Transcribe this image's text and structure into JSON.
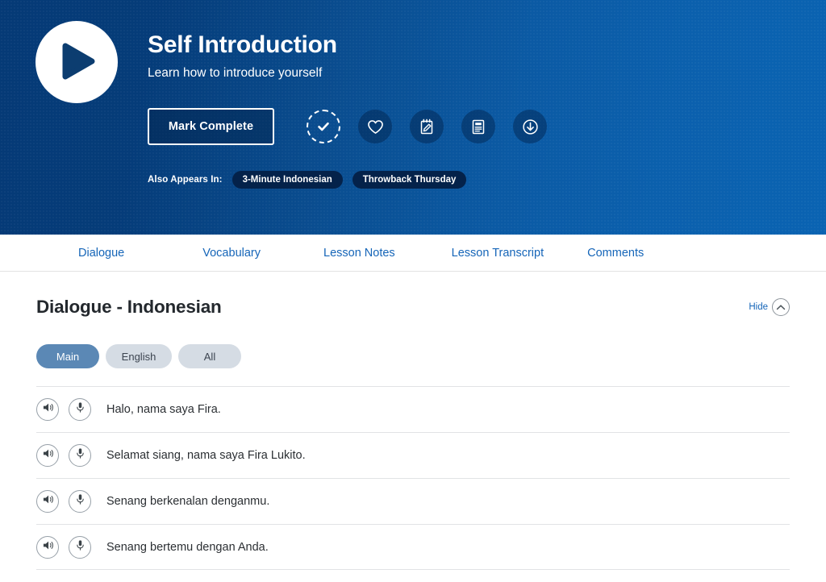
{
  "hero": {
    "play_icon": "play-icon",
    "title": "Self Introduction",
    "subtitle": "Learn how to introduce yourself",
    "mark_complete_label": "Mark Complete",
    "action_icons": [
      {
        "name": "check-circle-dashed-icon",
        "label": "Mark as complete"
      },
      {
        "name": "heart-icon",
        "label": "Favorite"
      },
      {
        "name": "notepad-pencil-icon",
        "label": "Notes"
      },
      {
        "name": "lesson-notes-icon",
        "label": "Lesson notes"
      },
      {
        "name": "download-icon",
        "label": "Download"
      }
    ],
    "appears_label": "Also Appears In:",
    "appears_chips": [
      "3-Minute Indonesian",
      "Throwback Thursday"
    ],
    "gradient_from": "#053a76",
    "gradient_to": "#0a63b2"
  },
  "nav": {
    "tabs": [
      {
        "label": "Dialogue"
      },
      {
        "label": "Vocabulary"
      },
      {
        "label": "Lesson Notes"
      },
      {
        "label": "Lesson Transcript"
      },
      {
        "label": "Comments"
      }
    ],
    "link_color": "#1565b8"
  },
  "section": {
    "title": "Dialogue - Indonesian",
    "hide_label": "Hide",
    "hide_icon": "chevron-up-circle-icon"
  },
  "filters": {
    "pills": [
      {
        "label": "Main",
        "active": true
      },
      {
        "label": "English",
        "active": false
      },
      {
        "label": "All",
        "active": false
      }
    ],
    "active_color": "#5b88b5",
    "inactive_color": "#d5dce4"
  },
  "dialogue": {
    "rows": [
      {
        "audio_icon": "speaker-icon",
        "record_icon": "microphone-icon",
        "text": "Halo, nama saya Fira."
      },
      {
        "audio_icon": "speaker-icon",
        "record_icon": "microphone-icon",
        "text": "Selamat siang, nama saya Fira Lukito."
      },
      {
        "audio_icon": "speaker-icon",
        "record_icon": "microphone-icon",
        "text": "Senang berkenalan denganmu."
      },
      {
        "audio_icon": "speaker-icon",
        "record_icon": "microphone-icon",
        "text": "Senang bertemu dengan Anda."
      }
    ]
  }
}
